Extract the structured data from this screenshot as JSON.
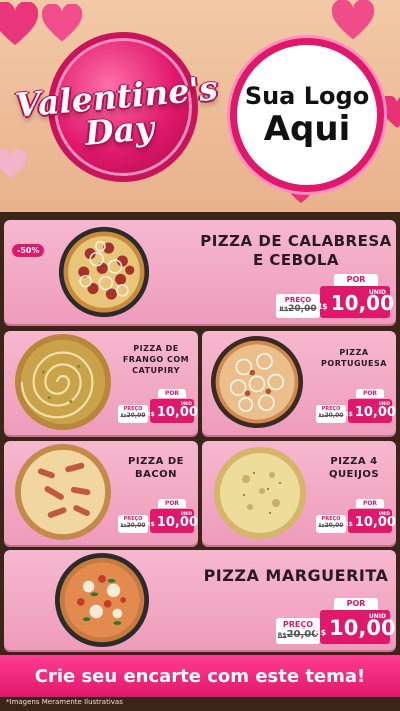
{
  "header": {
    "title_line1": "Valentine's",
    "title_line2": "Day",
    "logo_line1": "Sua Logo",
    "logo_line2": "Aqui"
  },
  "colors": {
    "accent": "#e0186b",
    "card": "#f3a9c5",
    "wood": "#3b2418",
    "header_bg": "#efc09c"
  },
  "price_labels": {
    "old_label": "PREÇO",
    "por": "POR",
    "currency": "R$",
    "unit": "UNID"
  },
  "products": [
    {
      "name": "PIZZA DE CALABRESA E CEBOLA",
      "badge": "-50%",
      "old_price": "20,00",
      "old_prefix": "R$",
      "price": "10,00",
      "icon": "pizza-calabresa-icon"
    },
    {
      "name": "PIZZA DE FRANGO COM CATUPIRY",
      "old_price": "20,00",
      "old_prefix": "R$",
      "price": "10,00",
      "icon": "pizza-frango-icon"
    },
    {
      "name": "PIZZA PORTUGUESA",
      "old_price": "20,00",
      "old_prefix": "R$",
      "price": "10,00",
      "icon": "pizza-portuguesa-icon"
    },
    {
      "name": "PIZZA DE BACON",
      "old_price": "20,00",
      "old_prefix": "R$",
      "price": "10,00",
      "icon": "pizza-bacon-icon"
    },
    {
      "name": "PIZZA 4 QUEIJOS",
      "old_price": "20,00",
      "old_prefix": "R$",
      "price": "10,00",
      "icon": "pizza-queijos-icon"
    },
    {
      "name": "PIZZA MARGUERITA",
      "old_price": "20,00",
      "old_prefix": "R$",
      "price": "10,00",
      "icon": "pizza-marguerita-icon"
    }
  ],
  "footer": {
    "banner": "Crie seu encarte com este tema!",
    "disclaimer": "*Imagens Meramente Ilustrativas"
  }
}
